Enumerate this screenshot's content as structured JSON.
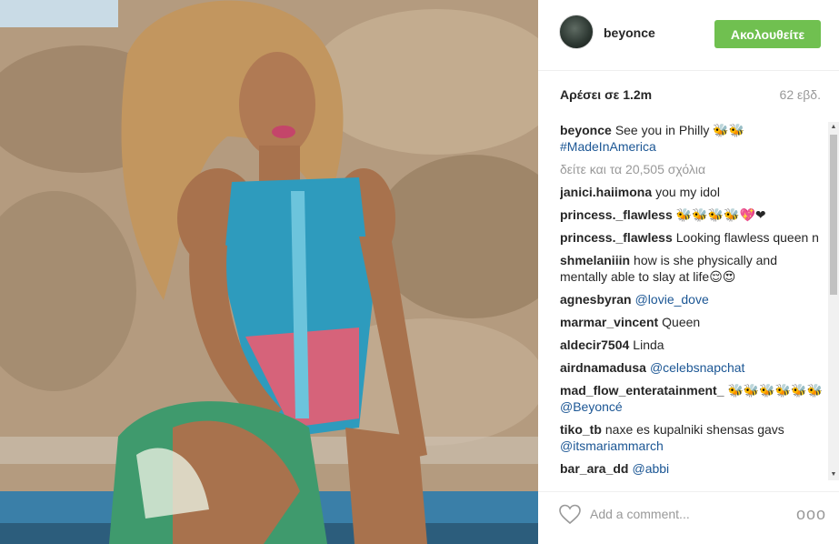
{
  "post": {
    "username": "beyonce",
    "follow_label": "Ακολουθείτε",
    "likes": "Αρέσει σε 1.2m",
    "age": "62 εβδ."
  },
  "caption": {
    "user": "beyonce",
    "text": "See you in Philly 🐝🐝",
    "hashtag": "#MadeInAmerica"
  },
  "load_more": "δείτε και τα 20,505 σχόλια",
  "comments": [
    {
      "user": "janici.haiimona",
      "text": "you my idol",
      "tag": ""
    },
    {
      "user": "princess._flawless",
      "text": "🐝🐝🐝🐝💖❤",
      "tag": ""
    },
    {
      "user": "princess._flawless",
      "text": "Looking flawless queen n",
      "tag": ""
    },
    {
      "user": "shmelaniiin",
      "text": "how is she physically and mentally able to slay at life😌😍",
      "tag": ""
    },
    {
      "user": "agnesbyran",
      "text": "",
      "tag": "@lovie_dove"
    },
    {
      "user": "marmar_vincent",
      "text": "Queen",
      "tag": ""
    },
    {
      "user": "aldecir7504",
      "text": "Linda",
      "tag": ""
    },
    {
      "user": "airdnamadusa",
      "text": "",
      "tag": "@celebsnapchat"
    },
    {
      "user": "mad_flow_enteratainment_",
      "text": "🐝🐝🐝🐝🐝🐝",
      "tag": "@Beyoncé"
    },
    {
      "user": "tiko_tb",
      "text": "naxe es kupalniki shensas gavs",
      "tag": "@itsmariammarch"
    },
    {
      "user": "bar_ara_dd",
      "text": "",
      "tag": "@abbi"
    }
  ],
  "footer": {
    "placeholder": "Add a comment...",
    "more_label": "ooo"
  },
  "icons": {
    "heart": "heart-icon",
    "more": "more-options-icon"
  },
  "colors": {
    "follow_button": "#70c050",
    "link": "#1b5694",
    "muted": "#999999"
  }
}
